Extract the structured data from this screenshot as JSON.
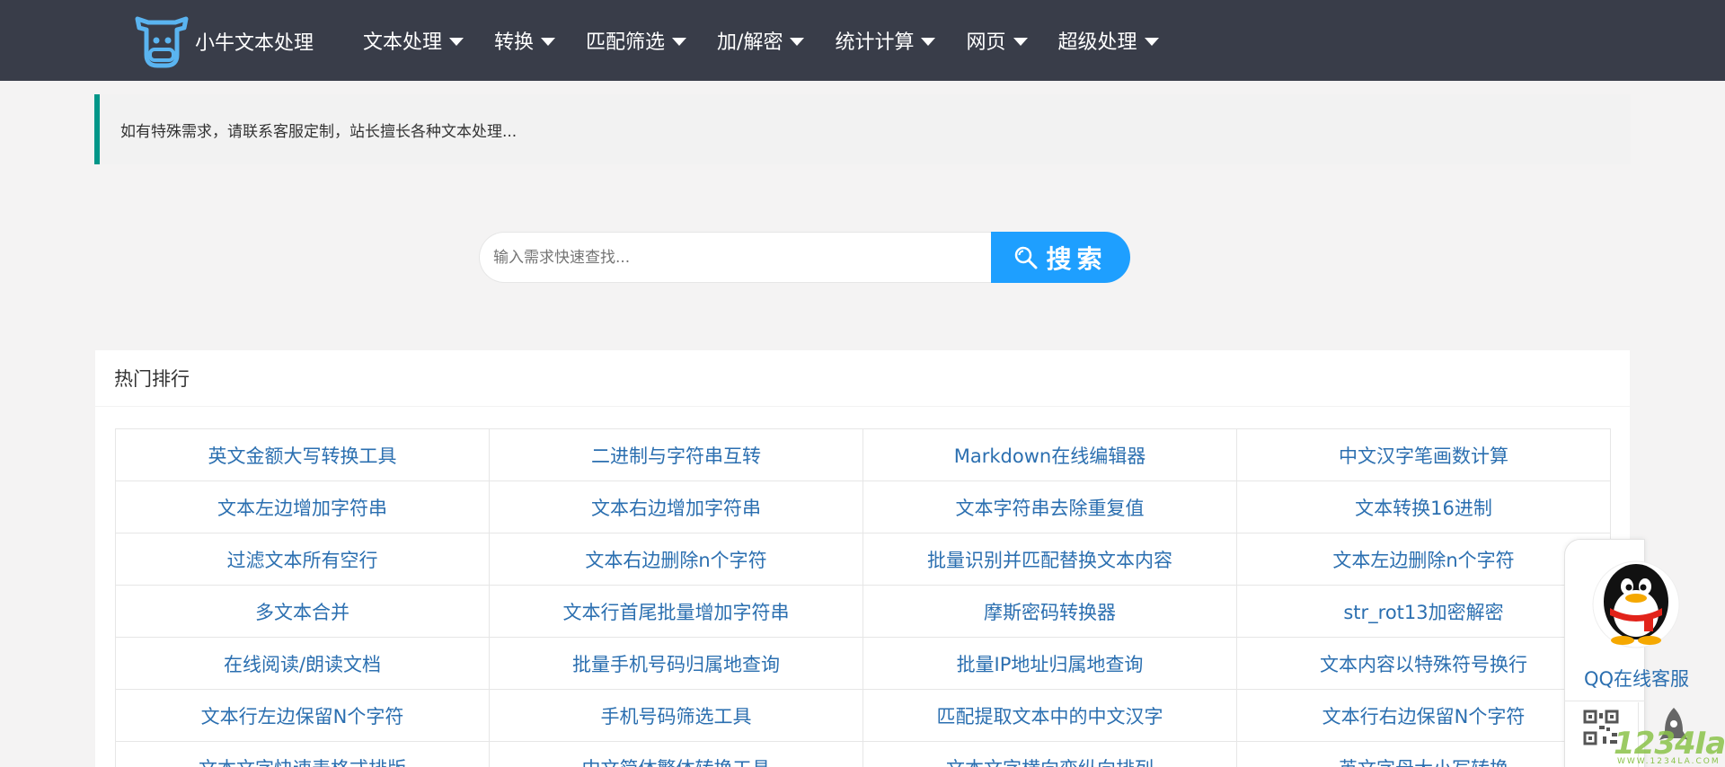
{
  "header": {
    "logo_text": "小牛文本处理",
    "nav": [
      {
        "label": "文本处理"
      },
      {
        "label": "转换"
      },
      {
        "label": "匹配筛选"
      },
      {
        "label": "加/解密"
      },
      {
        "label": "统计计算"
      },
      {
        "label": "网页"
      },
      {
        "label": "超级处理"
      }
    ]
  },
  "notice": {
    "text": "如有特殊需求，请联系客服定制，站长擅长各种文本处理..."
  },
  "search": {
    "placeholder": "输入需求快速查找...",
    "button_label": "搜索"
  },
  "hot": {
    "title": "热门排行",
    "items": [
      "英文金额大写转换工具",
      "二进制与字符串互转",
      "Markdown在线编辑器",
      "中文汉字笔画数计算",
      "文本左边增加字符串",
      "文本右边增加字符串",
      "文本字符串去除重复值",
      "文本转换16进制",
      "过滤文本所有空行",
      "文本右边删除n个字符",
      "批量识别并匹配替换文本内容",
      "文本左边删除n个字符",
      "多文本合并",
      "文本行首尾批量增加字符串",
      "摩斯密码转换器",
      "str_rot13加密解密",
      "在线阅读/朗读文档",
      "批量手机号码归属地查询",
      "批量IP地址归属地查询",
      "文本内容以特殊符号换行",
      "文本行左边保留N个字符",
      "手机号码筛选工具",
      "匹配提取文本中的中文汉字",
      "文本行右边保留N个字符",
      "文本文字快速表格式排版",
      "中文简体繁体转换工具",
      "文本文字横向变纵向排列",
      "英文字母大小写转换"
    ]
  },
  "float_service": {
    "qq_label": "QQ在线客服"
  },
  "watermark": {
    "text": "1234Ia",
    "sub": "WWW.1234LA.COM"
  },
  "colors": {
    "header_bg": "#393d49",
    "accent_green": "#009688",
    "search_blue": "#1e9fff",
    "link_blue": "#2b6fb0"
  }
}
